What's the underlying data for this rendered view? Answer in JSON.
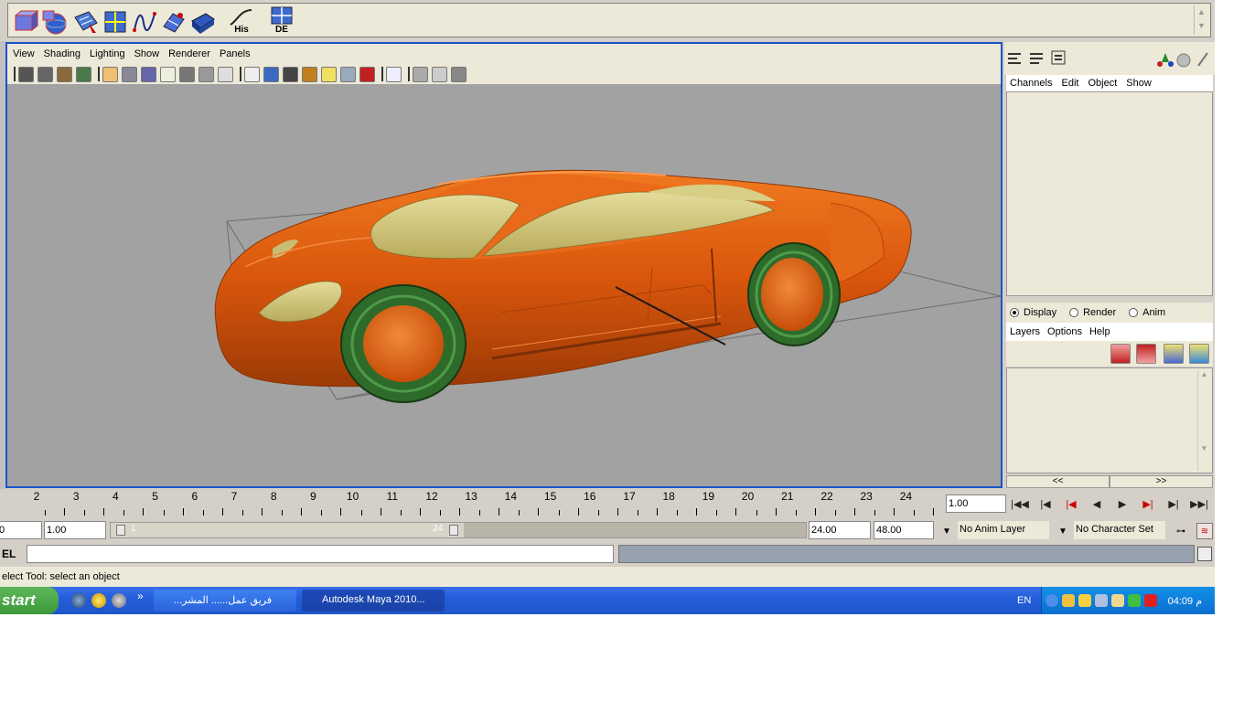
{
  "shelf": {
    "icons": [
      {
        "name": "cube-nurbs-icon",
        "label": ""
      },
      {
        "name": "sphere-nurbs-icon",
        "label": ""
      },
      {
        "name": "select-surface-icon",
        "label": ""
      },
      {
        "name": "grid-surface-icon",
        "label": ""
      },
      {
        "name": "curve-icon",
        "label": ""
      },
      {
        "name": "loft-icon",
        "label": ""
      },
      {
        "name": "extrude-icon",
        "label": ""
      },
      {
        "name": "history-icon",
        "label": "His"
      },
      {
        "name": "delete-history-icon",
        "label": "DE"
      }
    ]
  },
  "viewport": {
    "menu": [
      "View",
      "Shading",
      "Lighting",
      "Show",
      "Renderer",
      "Panels"
    ]
  },
  "channelbox": {
    "menu": [
      "Channels",
      "Edit",
      "Object",
      "Show"
    ]
  },
  "layers": {
    "modes": [
      "Display",
      "Render",
      "Anim"
    ],
    "selected_mode": "Display",
    "menu": [
      "Layers",
      "Options",
      "Help"
    ],
    "nav_left": "<<",
    "nav_right": ">>"
  },
  "timeline": {
    "ticks": [
      "2",
      "3",
      "4",
      "5",
      "6",
      "7",
      "8",
      "9",
      "10",
      "11",
      "12",
      "13",
      "14",
      "15",
      "16",
      "17",
      "18",
      "19",
      "20",
      "21",
      "22",
      "23",
      "24"
    ],
    "current_time": "1.00"
  },
  "range": {
    "start_frame": "0",
    "start_time": "1.00",
    "range_start_label": "1",
    "range_end_label": "24",
    "end_time": "24.00",
    "end_frame": "48.00",
    "anim_layer": "No Anim Layer",
    "character_set": "No Character Set"
  },
  "command": {
    "label": "EL",
    "help": "elect Tool: select an object"
  },
  "taskbar": {
    "start": "start",
    "more": "»",
    "tasks": [
      {
        "label": "...فريق عمل...... المشر"
      },
      {
        "label": "Autodesk Maya 2010..."
      }
    ],
    "lang": "EN",
    "clock": "04:09 م"
  },
  "colors": {
    "viewport_bg": "#a2a2a2",
    "car_body": "#d9560c",
    "windows": "#cfc47a",
    "tires": "#2e6b2a",
    "panel_border": "#1c53c8"
  }
}
